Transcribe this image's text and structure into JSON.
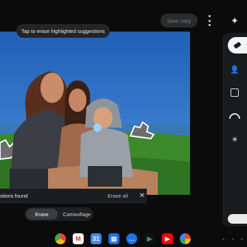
{
  "toolbar": {
    "save_copy_label": "Save copy",
    "more_icon": "more-vert-icon",
    "sparkle_icon": "sparkle-icon"
  },
  "hint": {
    "text": "Tap to erase highlighted suggestions"
  },
  "suggestions_bar": {
    "text": "stions found",
    "erase_all_label": "Erase all",
    "close_icon": "close-icon"
  },
  "mode_switch": {
    "options": [
      "Erase",
      "Camouflage"
    ],
    "selected": "Erase"
  },
  "tools": {
    "items": [
      "eraser-icon",
      "person-portrait-icon",
      "image-icon",
      "rainbow-icon",
      "brightness-icon"
    ],
    "selected": "eraser-icon"
  },
  "dock": {
    "apps": [
      "chrome-icon",
      "gmail-icon",
      "calendar-icon",
      "files-icon",
      "messages-icon",
      "play-store-icon",
      "youtube-icon",
      "photos-icon"
    ]
  },
  "colors": {
    "background": "#0b0b0c",
    "panel": "#1a1b1d",
    "accent_link": "#a8c7fa",
    "sky": "#2a6fc0",
    "grass": "#3c8a2b"
  }
}
